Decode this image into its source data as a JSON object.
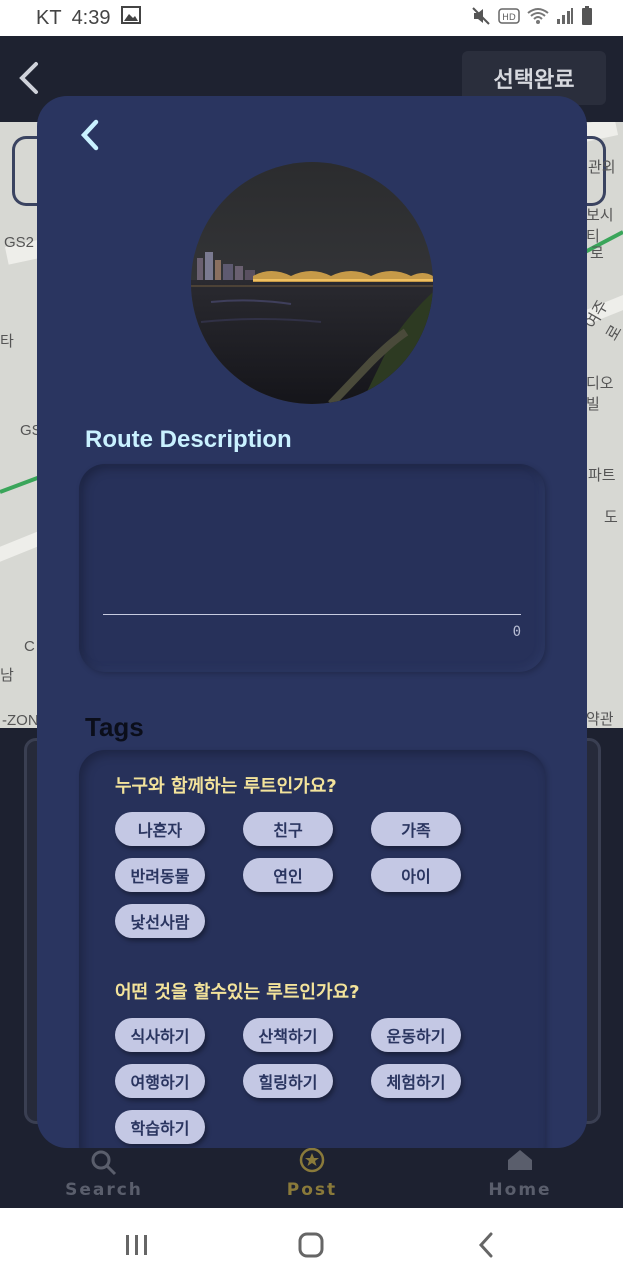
{
  "status_bar": {
    "carrier": "KT",
    "time": "4:39"
  },
  "app_header": {
    "done_label": "선택완료"
  },
  "map": {
    "labels": [
      "GS2",
      "GS",
      "타",
      "C",
      "남",
      "-ZON",
      "관외",
      "보시티",
      "로",
      "여주로",
      "디오빌",
      "파트",
      "도",
      "약관"
    ]
  },
  "modal": {
    "route_description_title": "Route Description",
    "description_count": "0",
    "tags_title": "Tags",
    "sections": [
      {
        "question": "누구와 함께하는 루트인가요?",
        "chips": [
          "나혼자",
          "친구",
          "가족",
          "반려동물",
          "연인",
          "아이",
          "낯선사람"
        ]
      },
      {
        "question": "어떤 것을 할수있는 루트인가요?",
        "chips": [
          "식사하기",
          "산책하기",
          "운동하기",
          "여행하기",
          "힐링하기",
          "체험하기",
          "학습하기"
        ]
      }
    ]
  },
  "bottom_nav": {
    "items": [
      {
        "label": "Search",
        "icon": "search-icon",
        "color": "#5a5e6c"
      },
      {
        "label": "Post",
        "icon": "star-circle-icon",
        "color": "#8a7a3a"
      },
      {
        "label": "Home",
        "icon": "home-icon",
        "color": "#5a5e6c"
      }
    ]
  },
  "colors": {
    "modal_bg": "#2a3560",
    "chip_bg": "#c4c8e4",
    "question_text": "#f3e39b",
    "title_text": "#c9f1ff"
  }
}
